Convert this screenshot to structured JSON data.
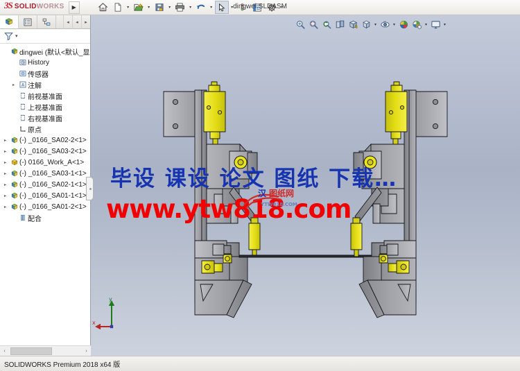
{
  "window": {
    "document_title": "dingwei.SLDASM",
    "product_name": "SOLIDWORKS",
    "brand_mark": "3S",
    "brand_name_bold": "SOLID",
    "brand_name_light": "WORKS",
    "menu_expand_label": "▶"
  },
  "toolbar": {
    "buttons": [
      {
        "name": "home-icon",
        "label": "Home",
        "caret": false
      },
      {
        "name": "new-document-icon",
        "label": "New",
        "caret": true
      },
      {
        "name": "open-document-icon",
        "label": "Open",
        "caret": true
      },
      {
        "name": "save-icon",
        "label": "Save",
        "caret": true
      },
      {
        "name": "print-icon",
        "label": "Print",
        "caret": true
      },
      {
        "name": "undo-icon",
        "label": "Undo",
        "caret": true
      },
      {
        "name": "select-cursor-icon",
        "label": "Select",
        "caret": true,
        "selected": true
      },
      {
        "name": "rebuild-icon",
        "label": "Rebuild",
        "caret": false
      },
      {
        "name": "options-list-icon",
        "label": "File Properties",
        "caret": false
      },
      {
        "name": "settings-gear-icon",
        "label": "Options",
        "caret": true
      }
    ]
  },
  "headsup_toolbar": {
    "buttons": [
      {
        "name": "zoom-to-fit-icon",
        "label": "Zoom to Fit",
        "caret": false
      },
      {
        "name": "zoom-to-area-icon",
        "label": "Zoom to Area",
        "caret": false
      },
      {
        "name": "previous-view-icon",
        "label": "Previous View",
        "caret": false
      },
      {
        "name": "section-view-icon",
        "label": "Section View",
        "caret": false
      },
      {
        "name": "view-orientation-icon",
        "label": "View Orientation",
        "caret": false
      },
      {
        "name": "display-style-icon",
        "label": "Display Style",
        "caret": true
      },
      {
        "name": "hide-show-items-icon",
        "label": "Hide/Show Items",
        "caret": true
      },
      {
        "name": "edit-appearance-icon",
        "label": "Edit Appearance",
        "caret": true
      },
      {
        "name": "apply-scene-icon",
        "label": "Apply Scene",
        "caret": false
      },
      {
        "name": "view-settings-icon",
        "label": "View Settings",
        "caret": true
      },
      {
        "name": "viewport-icon",
        "label": "Viewport",
        "caret": true
      }
    ]
  },
  "left_panel": {
    "tabs": [
      {
        "name": "feature-manager-tab",
        "label": "FeatureManager 设计树",
        "active": true
      },
      {
        "name": "property-manager-tab",
        "label": "PropertyManager",
        "active": false
      },
      {
        "name": "configuration-manager-tab",
        "label": "ConfigurationManager",
        "active": false
      }
    ],
    "nav_buttons": [
      "◂",
      "◂",
      "▸"
    ],
    "filter_label": "过滤器",
    "tree": [
      {
        "label": "dingwei  (默认<默认_显示",
        "icon": "assembly-icon",
        "indent": 0,
        "expander": ""
      },
      {
        "label": "History",
        "icon": "history-icon",
        "indent": 1,
        "expander": ""
      },
      {
        "label": "传感器",
        "icon": "sensor-icon",
        "indent": 1,
        "expander": ""
      },
      {
        "label": "注解",
        "icon": "annotation-icon",
        "indent": 1,
        "expander": "▸"
      },
      {
        "label": "前视基准面",
        "icon": "plane-icon",
        "indent": 1,
        "expander": ""
      },
      {
        "label": "上视基准面",
        "icon": "plane-icon",
        "indent": 1,
        "expander": ""
      },
      {
        "label": "右视基准面",
        "icon": "plane-icon",
        "indent": 1,
        "expander": ""
      },
      {
        "label": "原点",
        "icon": "origin-icon",
        "indent": 1,
        "expander": ""
      },
      {
        "label": "(-) _0166_SA02-2<1>",
        "icon": "component-icon",
        "indent": 0,
        "expander": "▸"
      },
      {
        "label": "(-) _0166_SA03-2<1>",
        "icon": "component-icon",
        "indent": 0,
        "expander": "▸"
      },
      {
        "label": "(-) 0166_Work_A<1>",
        "icon": "component-yellow-icon",
        "indent": 0,
        "expander": "▸"
      },
      {
        "label": "(-) _0166_SA03-1<1>",
        "icon": "component-icon",
        "indent": 0,
        "expander": "▸"
      },
      {
        "label": "(-) _0166_SA02-1<1>",
        "icon": "component-icon",
        "indent": 0,
        "expander": "▸"
      },
      {
        "label": "(-) _0166_SA01-1<1>",
        "icon": "component-icon",
        "indent": 0,
        "expander": "▸"
      },
      {
        "label": "(-) _0166_SA01-2<1>",
        "icon": "component-icon",
        "indent": 0,
        "expander": "▸"
      },
      {
        "label": "配合",
        "icon": "mates-icon",
        "indent": 1,
        "expander": ""
      }
    ],
    "scroll_left_arrow": "‹",
    "scroll_right_arrow": "›"
  },
  "graphics": {
    "watermark_line1": "毕设  课设  论文  图纸  下载…",
    "watermark_line2": "www.ytw818.com",
    "watermark_logo_cn": "汉 图纸网",
    "watermark_logo_url": "YTW818.COM",
    "axis_x_label": "x",
    "axis_y_label": "y",
    "colors": {
      "background_top": "#c4cbda",
      "background_bottom": "#cdd3de",
      "watermark_blue": "#1633b0",
      "watermark_red": "#f00000",
      "part_steel": "#a9aab0",
      "part_yellow": "#e8e21e",
      "edge": "#1a1a1a"
    }
  },
  "statusbar": {
    "text": "SOLIDWORKS Premium 2018 x64 版"
  }
}
